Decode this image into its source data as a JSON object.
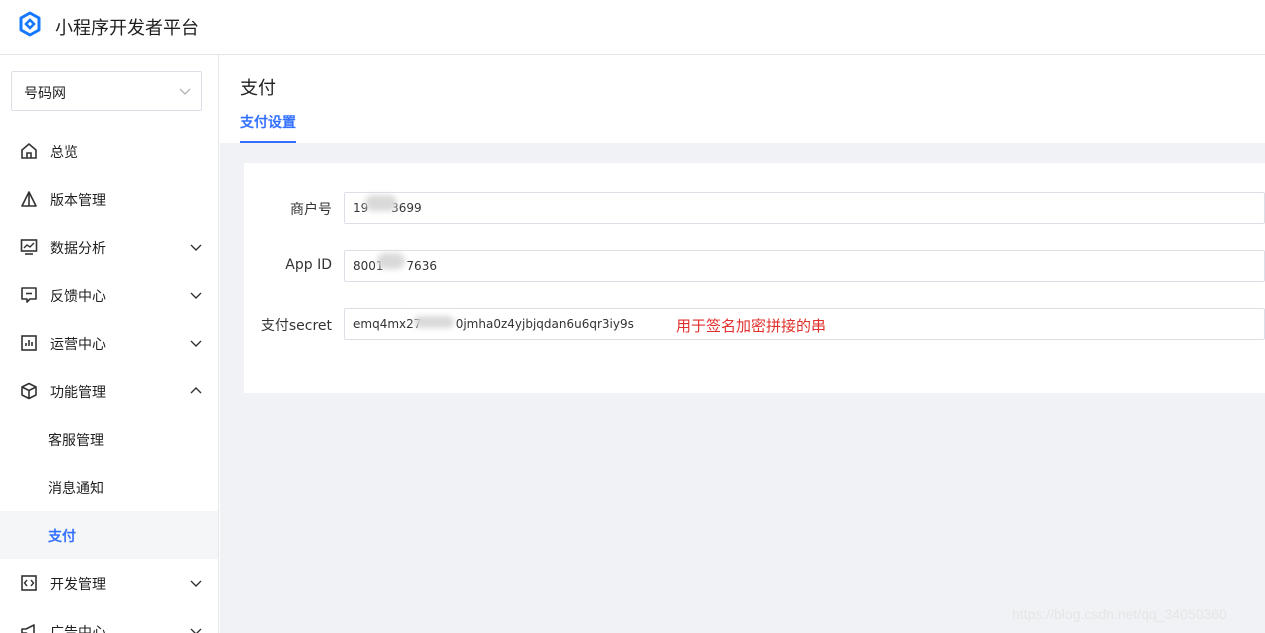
{
  "app": {
    "title": "小程序开发者平台"
  },
  "account": {
    "selected": "号码网"
  },
  "sidebar": {
    "items": [
      {
        "label": "总览"
      },
      {
        "label": "版本管理"
      },
      {
        "label": "数据分析"
      },
      {
        "label": "反馈中心"
      },
      {
        "label": "运营中心"
      },
      {
        "label": "功能管理"
      },
      {
        "label": "开发管理"
      },
      {
        "label": "广告中心"
      }
    ],
    "sub_items": [
      {
        "label": "客服管理"
      },
      {
        "label": "消息通知"
      },
      {
        "label": "支付"
      }
    ]
  },
  "page": {
    "title": "支付",
    "tabs": [
      {
        "label": "支付设置"
      }
    ]
  },
  "form": {
    "merchant_id": {
      "label": "商户号",
      "value": "19      3699"
    },
    "app_id": {
      "label": "App ID",
      "value": "8001      7636"
    },
    "secret": {
      "label": "支付secret",
      "value": "emq4mx27         0jmha0z4yjbjqdan6u6qr3iy9s",
      "note": "用于签名加密拼接的串"
    }
  },
  "watermark": "https://blog.csdn.net/qq_34050360",
  "colors": {
    "accent": "#3370ff",
    "note": "#e0302d"
  }
}
